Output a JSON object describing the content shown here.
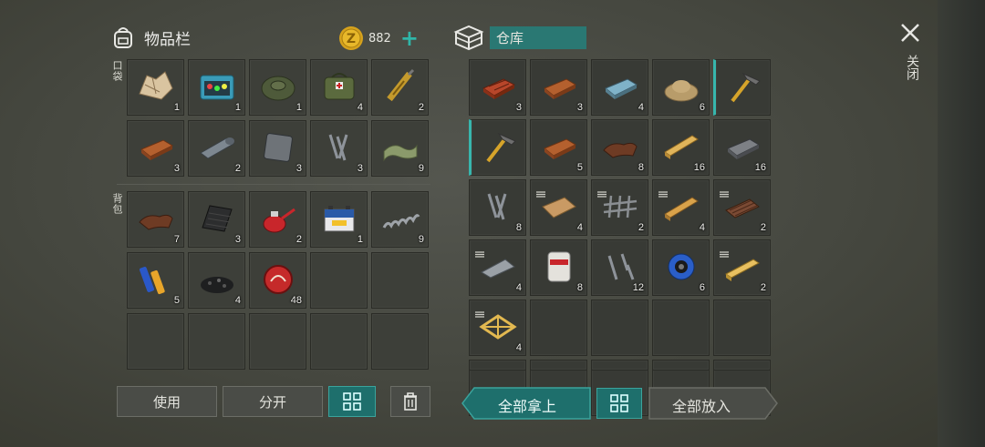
{
  "inventory": {
    "title": "物品栏",
    "coins": "882",
    "pocket_label": "口袋",
    "backpack_label": "背包",
    "pocket_items": [
      {
        "name": "map",
        "count": "1"
      },
      {
        "name": "tackle-box",
        "count": "1"
      },
      {
        "name": "landmine",
        "count": "1"
      },
      {
        "name": "medic-bag",
        "count": "4"
      },
      {
        "name": "syringe-vial",
        "count": "2"
      },
      {
        "name": "copper-ingot",
        "count": "3"
      },
      {
        "name": "metal-sheet-roll",
        "count": "2"
      },
      {
        "name": "steel-plate",
        "count": "3"
      },
      {
        "name": "nails",
        "count": "3"
      },
      {
        "name": "cloth",
        "count": "9"
      }
    ],
    "backpack_items": [
      {
        "name": "leather",
        "count": "7"
      },
      {
        "name": "rubber-mat",
        "count": "3"
      },
      {
        "name": "oil-can",
        "count": "2"
      },
      {
        "name": "car-battery",
        "count": "1"
      },
      {
        "name": "spring",
        "count": "9"
      },
      {
        "name": "batteries",
        "count": "5"
      },
      {
        "name": "gravel",
        "count": "4"
      },
      {
        "name": "bottle-caps",
        "count": "48"
      }
    ]
  },
  "storage": {
    "title": "仓库",
    "items": [
      {
        "name": "brick",
        "count": "3"
      },
      {
        "name": "copper-ingot",
        "count": "3"
      },
      {
        "name": "steel-ingot",
        "count": "4"
      },
      {
        "name": "sand",
        "count": "6"
      },
      {
        "name": "hammer",
        "count": ""
      },
      {
        "name": "hammer",
        "count": ""
      },
      {
        "name": "copper-ingot",
        "count": "5"
      },
      {
        "name": "leather",
        "count": "8"
      },
      {
        "name": "wood-plank",
        "count": "16"
      },
      {
        "name": "iron-ingot",
        "count": "16"
      },
      {
        "name": "nails",
        "count": "8"
      },
      {
        "name": "plywood",
        "count": "4"
      },
      {
        "name": "rebar-mesh",
        "count": "2"
      },
      {
        "name": "wood-beam",
        "count": "4"
      },
      {
        "name": "corrugated-sheet",
        "count": "2"
      },
      {
        "name": "metal-sheet",
        "count": "4"
      },
      {
        "name": "asbestos-bag",
        "count": "8"
      },
      {
        "name": "screws",
        "count": "12"
      },
      {
        "name": "wire-spool",
        "count": "6"
      },
      {
        "name": "wood-board",
        "count": "2"
      },
      {
        "name": "wood-frame",
        "count": "4"
      }
    ]
  },
  "buttons": {
    "use": "使用",
    "split": "分开",
    "take_all": "全部拿上",
    "put_all": "全部放入",
    "close": "关闭"
  },
  "colors": {
    "accent": "#2a8c86",
    "coin": "#d6a21c"
  }
}
